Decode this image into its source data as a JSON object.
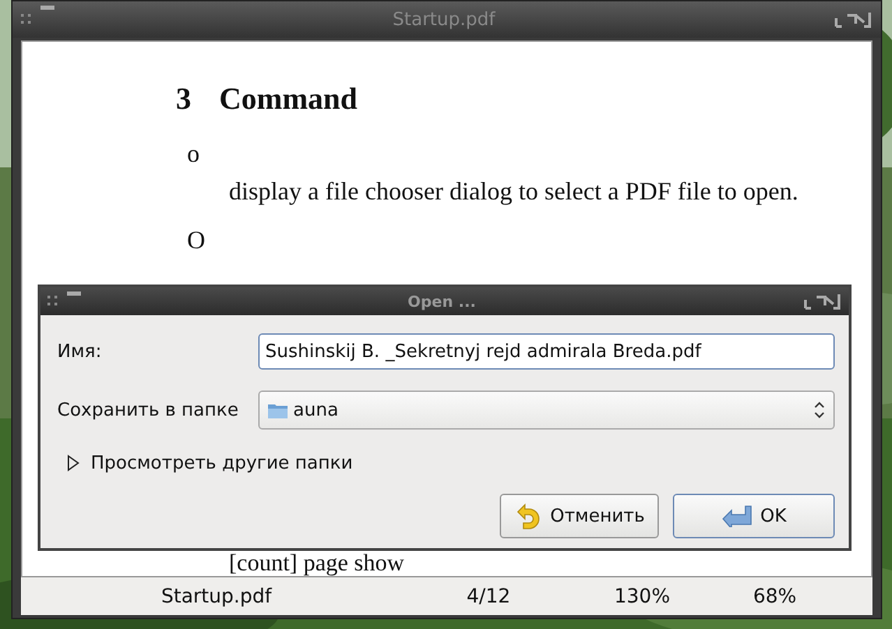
{
  "window": {
    "title": "Startup.pdf"
  },
  "document": {
    "heading_number": "3",
    "heading": "Command",
    "items": [
      {
        "key": "o",
        "text": "display a file chooser dialog to select a PDF file to open."
      },
      {
        "key": "O"
      }
    ],
    "trailing_text": "[count] page show"
  },
  "status_bar": {
    "file": "Startup.pdf",
    "page": "4/12",
    "zoom": "130%",
    "percent": "68%"
  },
  "dialog": {
    "title": "Open ...",
    "name_label": "Имя:",
    "name_value": "Sushinskij B. _Sekretnyj rejd admirala Breda.pdf",
    "folder_label": "Сохранить в папке",
    "folder_value": "auna",
    "expander": {
      "label": "Просмотреть другие папки",
      "expanded": false
    },
    "buttons": [
      {
        "label": "Отменить",
        "kind": "cancel"
      },
      {
        "label": "OK",
        "kind": "ok"
      }
    ]
  }
}
